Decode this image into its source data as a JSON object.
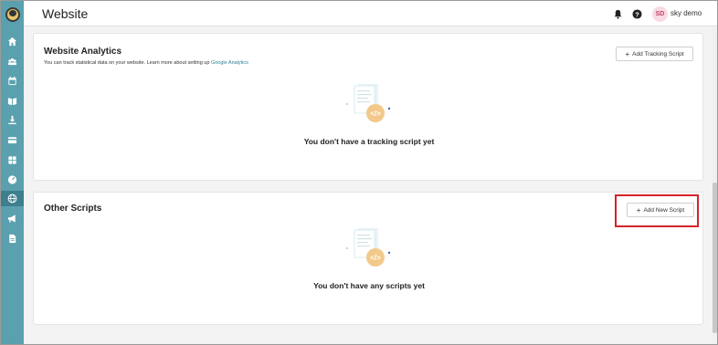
{
  "topbar": {
    "title": "Website",
    "user_initials": "SD",
    "user_name": "sky demo"
  },
  "sidebar": {
    "items": [
      {
        "icon": "home-icon"
      },
      {
        "icon": "users-icon"
      },
      {
        "icon": "calendar-icon"
      },
      {
        "icon": "book-icon"
      },
      {
        "icon": "download-icon"
      },
      {
        "icon": "credit-card-icon"
      },
      {
        "icon": "grid-icon"
      },
      {
        "icon": "dashboard-icon"
      },
      {
        "icon": "globe-icon",
        "active": true
      },
      {
        "icon": "megaphone-icon"
      },
      {
        "icon": "document-icon"
      }
    ]
  },
  "analytics": {
    "title": "Website Analytics",
    "description": "You can track statistical data on your website. Learn more about setting up",
    "link_text": "Google Analytics",
    "button_label": "Add Tracking Script",
    "empty_text": "You don't have a tracking script yet"
  },
  "other_scripts": {
    "title": "Other Scripts",
    "button_label": "Add New Script",
    "empty_text": "You don't have any scripts yet"
  },
  "colors": {
    "sidebar": "#5aa0ae",
    "sidebar_active": "#3d7f8c",
    "highlight": "#d6232a",
    "link": "#2f7f9b"
  }
}
